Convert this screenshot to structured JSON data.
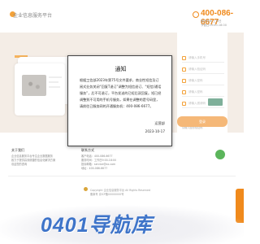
{
  "header": {
    "site_title": "企业信息服务平台",
    "hotline": "400-086-6677",
    "service_time_line1": "服务时间 工作日",
    "service_time_line2": "节假日09:00-18:00"
  },
  "login": {
    "field_1": "请输入手机号",
    "field_2": "请输入验证码",
    "field_3": "请输入密码",
    "field_4": "请输入密码",
    "field_5": "请输入邀请码",
    "agree_1": "我已阅读并同意服务协议",
    "agree_2": "请输入图形验证码",
    "submit": "登录"
  },
  "notice": {
    "title": "通知",
    "body": "根据工信部2023年第75号文件要求，商业性短信及订阅式业务关闭“回复T退订”调整为短信退订、“短信/通话服务”，后不可退订，平台发送的已短后双回复。短已经调整到不可用的手机号服务，如果在调整的是号码里，请前往已服务网的开通服务机：400-086-6677。",
    "sign": "运营部",
    "date": "2023-10-17"
  },
  "footer": {
    "col1_title": "关于我们",
    "col1_line1": "企业信息服务平台专注企业数据服务",
    "col1_line2": "致力于提供高效便捷的信息化解决方案",
    "col1_line3": "欢迎您的咨询",
    "col2_title": "联系方式",
    "col2_line1": "客户电话：400-086-6677",
    "col2_line2": "服务时间：工作日9:00-18:00",
    "col2_line3": "投诉邮箱：service@xx.com",
    "col2_line4": "地址：400-086-6677",
    "copyright_line1": "Copyright 企业信息服务平台 All Rights Reserved",
    "copyright_line2": "备案号 京ICP备00000000号"
  },
  "watermark": "0401导航库"
}
